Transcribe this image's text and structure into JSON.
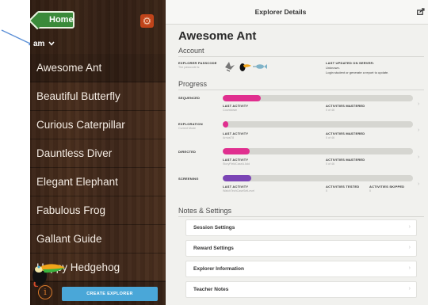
{
  "sidebar": {
    "home_label": "Home",
    "filter_label": "am",
    "explorers": [
      "Awesome Ant",
      "Beautiful Butterfly",
      "Curious Caterpillar",
      "Dauntless Diver",
      "Elegant Elephant",
      "Fabulous Frog",
      "Gallant Guide",
      "Happy Hedgehog"
    ],
    "selected_index": 0,
    "info_glyph": "i",
    "create_button": "CREATE EXPLORER"
  },
  "header": {
    "title": "Explorer Details"
  },
  "explorer": {
    "name": "Awesome Ant"
  },
  "account": {
    "section_title": "Account",
    "passcode_label": "EXPLORER PASSCODE",
    "passcode_sub": "The passcode is:",
    "last_updated_label": "LAST UPDATED ON SERVER:",
    "last_updated_value": "Unknown.",
    "last_updated_note": "Login student or generate a report to update."
  },
  "progress": {
    "section_title": "Progress",
    "rows": [
      {
        "name": "SEQUENCED",
        "sub": "",
        "fill": 0.2,
        "color": "#e02f8f",
        "activity_label": "LAST ACTIVITY",
        "activity_value": "Countdown",
        "mastered_label": "ACTIVITIES MASTERED",
        "mastered_value": "0 of 46"
      },
      {
        "name": "EXPLORATION",
        "sub": "Current Mode",
        "fill": 0.03,
        "color": "#e02f8f",
        "activity_label": "LAST ACTIVITY",
        "activity_value": "Arrival78",
        "mastered_label": "ACTIVITIES MASTERED",
        "mastered_value": "0 of 46"
      },
      {
        "name": "DIRECTED",
        "sub": "",
        "fill": 0.14,
        "color": "#e02f8f",
        "activity_label": "LAST ACTIVITY",
        "activity_value": "StoryFieldCaseA Add",
        "mastered_label": "ACTIVITIES MASTERED",
        "mastered_value": "0 of 46"
      },
      {
        "name": "SCREENING",
        "sub": "",
        "fill": 0.15,
        "color": "#7b45b5",
        "activity_label": "LAST ACTIVITY",
        "activity_value": "WatchTechCaseSetLevel",
        "mastered_label": "ACTIVITIES TESTED",
        "mastered_value": "0",
        "skipped_label": "ACTIVITIES SKIPPED",
        "skipped_value": "0"
      }
    ]
  },
  "notes": {
    "section_title": "Notes & Settings",
    "rows": [
      "Session Settings",
      "Reward Settings",
      "Explorer Information",
      "Teacher Notes"
    ]
  },
  "colors": {
    "accent_blue": "#4aa7d8",
    "progress_pink": "#e02f8f",
    "progress_purple": "#7b45b5",
    "home_green": "#3a8a3a",
    "gear_orange": "#c0441a"
  },
  "icons": {
    "gear": "gear-icon",
    "export": "export-icon",
    "chevron": "chevron-right-icon",
    "info": "info-icon"
  }
}
